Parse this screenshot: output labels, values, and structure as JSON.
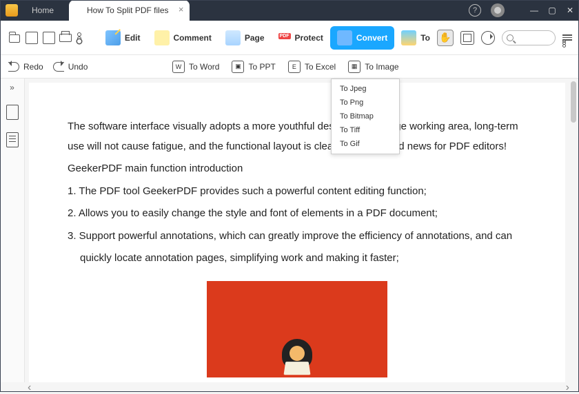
{
  "titlebar": {
    "home_label": "Home",
    "file_tab_label": "How To Split PDF files"
  },
  "quickbar": {},
  "ribbon": {
    "edit": "Edit",
    "comment": "Comment",
    "page": "Page",
    "protect": "Protect",
    "convert": "Convert",
    "tool": "To",
    "pdf_badge": "PDF"
  },
  "subbar": {
    "redo": "Redo",
    "undo": "Undo",
    "to_word": "To Word",
    "to_ppt": "To PPT",
    "to_excel": "To Excel",
    "to_image": "To Image"
  },
  "dropdown": {
    "items": [
      "To Jpeg",
      "To Png",
      "To Bitmap",
      "To Tiff",
      "To Gif"
    ]
  },
  "document": {
    "p1": "The software interface visually adopts a more youthful design, with a large working area, long-term use will not cause fatigue, and the functional layout is clear, which is good news for PDF editors!",
    "p2": "GeekerPDF main function introduction",
    "li1": "1. The PDF tool GeekerPDF provides such a powerful content editing function;",
    "li2": "2. Allows you to easily change the style and font of elements in a PDF document;",
    "li3": "3. Support powerful annotations, which can greatly improve the efficiency of annotations, and can",
    "li3b": "quickly locate annotation pages, simplifying work and making it faster;"
  }
}
